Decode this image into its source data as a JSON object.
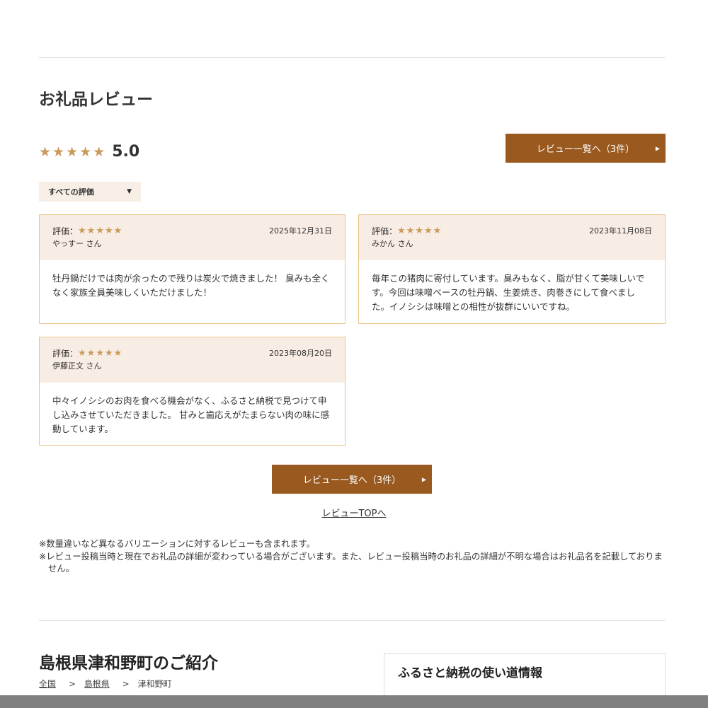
{
  "section_title": "お礼品レビュー",
  "average_rating": 5.0,
  "average_rating_label": "5.0",
  "review_list_button_label": "レビュー一覧へ（3件）",
  "filter": {
    "selected": "すべての評価"
  },
  "rating_prefix": "評価：",
  "reviews": [
    {
      "rating": 5,
      "date": "2025年12月31日",
      "user": "やっすー さん",
      "body": "牡丹鍋だけでは肉が余ったので残りは炭火で焼きました！ 臭みも全くなく家族全員美味しくいただけました！"
    },
    {
      "rating": 5,
      "date": "2023年11月08日",
      "user": "みかん さん",
      "body": "毎年この猪肉に寄付しています。臭みもなく、脂が甘くて美味しいです。今回は味噌ベースの牡丹鍋、生姜焼き、肉巻きにして食べました。イノシシは味噌との相性が抜群にいいですね。"
    },
    {
      "rating": 5,
      "date": "2023年08月20日",
      "user": "伊藤正文 さん",
      "body": "中々イノシシのお肉を食べる機会がなく、ふるさと納税で見つけて申し込みさせていただきました。 甘みと歯応えがたまらない肉の味に感動しています。"
    }
  ],
  "review_top_link": "レビューTOPへ",
  "notes": [
    "※数量違いなど異なるバリエーションに対するレビューも含まれます。",
    "※レビュー投稿当時と現在でお礼品の詳細が変わっている場合がございます。また、レビュー投稿当時のお礼品の詳細が不明な場合はお礼品名を記載しておりません。"
  ],
  "intro_title": "島根県津和野町のご紹介",
  "breadcrumb": [
    {
      "label": "全国",
      "link": true
    },
    {
      "label": "島根県",
      "link": true
    },
    {
      "label": "津和野町",
      "link": false
    }
  ],
  "breadcrumb_separator": ">",
  "side_box_title": "ふるさと納税の使い道情報",
  "icons": {
    "star": "star-icon",
    "arrow": "arrow-right-icon",
    "caret": "caret-down-icon"
  },
  "colors": {
    "accent": "#99591f",
    "star": "#c99a5b",
    "card_border": "#e9c58a",
    "card_header": "#f8ede4",
    "filter_bg": "#f7efe6"
  }
}
